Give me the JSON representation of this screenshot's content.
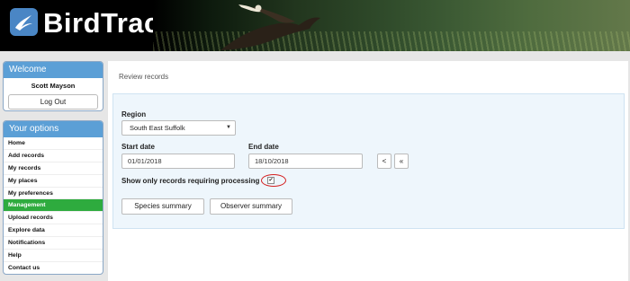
{
  "header": {
    "app_title": "BirdTrack",
    "logo_icon": "bird-logo-icon",
    "brand_color": "#4a86c5"
  },
  "sidebar": {
    "welcome": {
      "title": "Welcome",
      "user_name": "Scott Mayson",
      "logout_label": "Log Out"
    },
    "options": {
      "title": "Your options",
      "items": [
        {
          "label": "Home",
          "active": false
        },
        {
          "label": "Add records",
          "active": false
        },
        {
          "label": "My records",
          "active": false
        },
        {
          "label": "My places",
          "active": false
        },
        {
          "label": "My preferences",
          "active": false
        },
        {
          "label": "Management",
          "active": true
        },
        {
          "label": "Upload records",
          "active": false
        },
        {
          "label": "Explore data",
          "active": false
        },
        {
          "label": "Notifications",
          "active": false
        },
        {
          "label": "Help",
          "active": false
        },
        {
          "label": "Contact us",
          "active": false
        }
      ],
      "active_color": "#2eab3e"
    }
  },
  "main": {
    "page_title": "Review records",
    "form": {
      "region_label": "Region",
      "region_value": "South East Suffolk",
      "start_date_label": "Start date",
      "start_date_value": "01/01/2018",
      "end_date_label": "End date",
      "end_date_value": "18/10/2018",
      "prev_label": "<",
      "first_label": "«",
      "processing_label": "Show only records requiring processing",
      "processing_checked": true,
      "species_summary_label": "Species summary",
      "observer_summary_label": "Observer summary"
    }
  }
}
